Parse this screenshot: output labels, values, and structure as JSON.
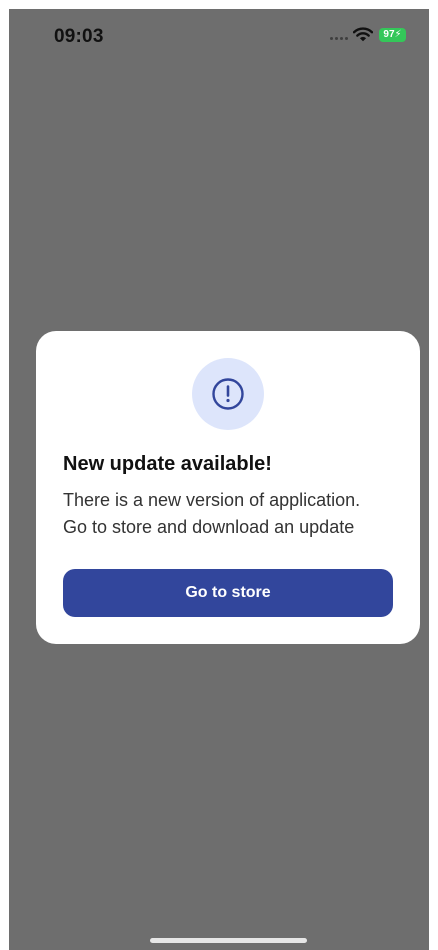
{
  "status_bar": {
    "time": "09:03",
    "battery": "97",
    "battery_color": "#34c759"
  },
  "dialog": {
    "icon": "exclamation-circle-icon",
    "title": "New update available!",
    "message_lines": [
      "There is a new version of application.",
      "Go to store and download an update"
    ],
    "button_label": "Go to store"
  },
  "colors": {
    "overlay": "#6e6e6e",
    "accent": "#32469c",
    "icon_badge": "#dde5fb"
  }
}
